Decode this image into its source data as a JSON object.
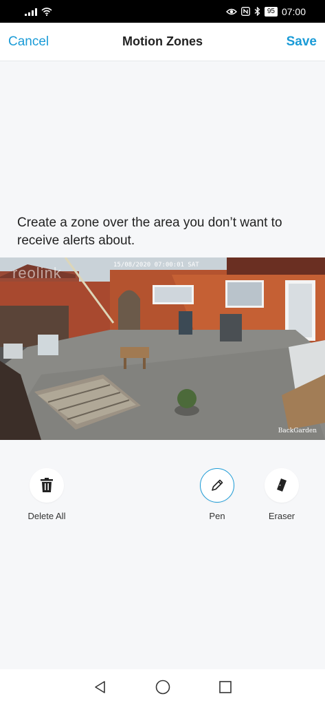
{
  "status_bar": {
    "battery": "95",
    "time": "07:00"
  },
  "header": {
    "cancel_label": "Cancel",
    "title": "Motion Zones",
    "save_label": "Save"
  },
  "instruction": "Create a zone over the area you don’t want to receive alerts about.",
  "camera": {
    "watermark": "reolink",
    "timestamp": "15/08/2020 07:00:01 SAT",
    "name": "BackGarden"
  },
  "tools": {
    "delete_all_label": "Delete All",
    "pen_label": "Pen",
    "eraser_label": "Eraser",
    "active": "Pen"
  },
  "colors": {
    "accent": "#1a9bd7",
    "background": "#f6f7f9"
  }
}
